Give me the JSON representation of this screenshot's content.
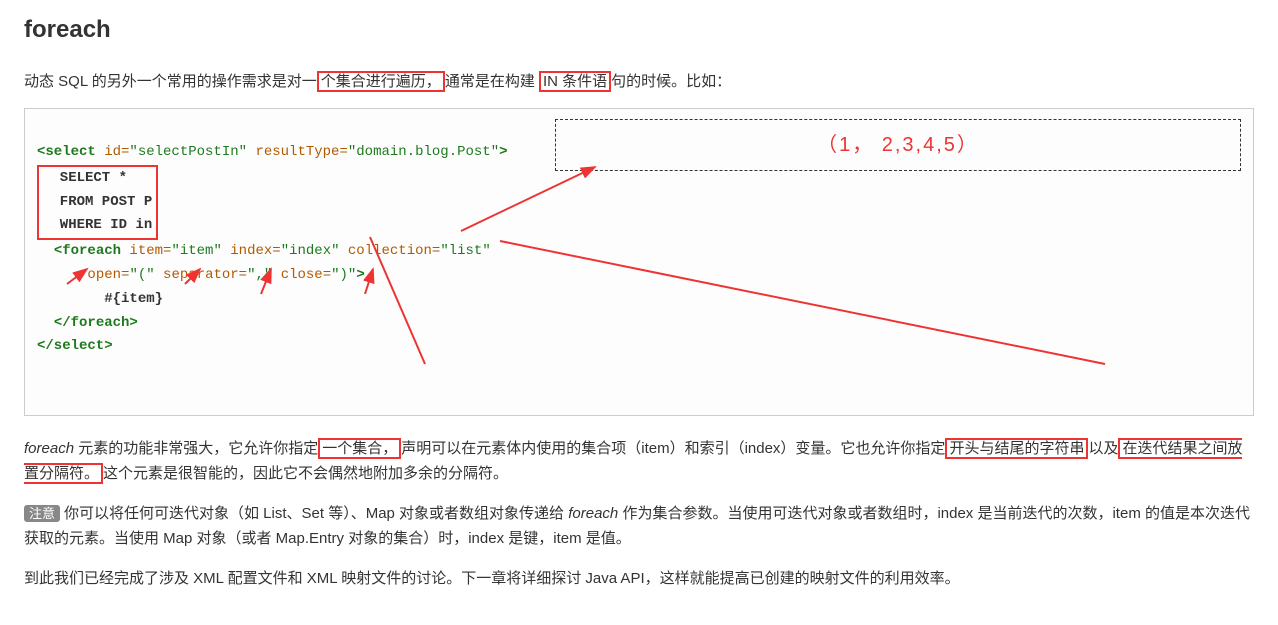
{
  "heading": "foreach",
  "intro": {
    "p1a": "动态 SQL 的另外一个常用的操作需求是对一",
    "hl1": "个集合进行遍历，",
    "p1b": "通常是在构建 ",
    "hl2": "IN 条件语",
    "p1c": "句的时候。比如："
  },
  "code": {
    "l1_open": "<select",
    "l1_id_attr": " id=",
    "l1_id_val": "\"selectPostIn\"",
    "l1_rt_attr": " resultType=",
    "l1_rt_val": "\"domain.blog.Post\"",
    "l1_close": ">",
    "l2": "  SELECT *",
    "l3": "  FROM POST P",
    "l4": "  WHERE ID in",
    "l5_indent": "  ",
    "l5_open": "<foreach",
    "l5_item_a": " item=",
    "l5_item_v": "\"item\"",
    "l5_idx_a": " index=",
    "l5_idx_v": "\"index\"",
    "l5_col_a": " collection=",
    "l5_col_v": "\"list\"",
    "l6_indent": "      ",
    "l6_open_a": "open=",
    "l6_open_v": "\"(\"",
    "l6_sep_a": " separator=",
    "l6_sep_v": "\",\"",
    "l6_close_a": " close=",
    "l6_close_v": "\")\"",
    "l6_gt": ">",
    "l7": "        #{item}",
    "l8_indent": "  ",
    "l8": "</foreach>",
    "l9": "</select>"
  },
  "dashbox_text": "（1， 2,3,4,5）",
  "para2": {
    "a": "foreach",
    "b": " 元素的功能非常强大，它允许你指定",
    "hl1": "一个集合，",
    "c": "声明可以在元素体内使用的集合项（item）和索引（index）变量。它也允许你指定",
    "hl2": "开头与结尾的字符串",
    "d": "以及",
    "hl3": "在迭代结果之间放置分隔符。",
    "e": "这个元素是很智能的，因此它不会偶然地附加多余的分隔符。"
  },
  "para3": {
    "tag": "注意",
    "a": "你可以将任何可迭代对象（如 List、Set 等）、Map 对象或者数组对象传递给 ",
    "b": "foreach",
    "c": " 作为集合参数。当使用可迭代对象或者数组时，index 是当前迭代的次数，item 的值是本次迭代获取的元素。当使用 Map 对象（或者 Map.Entry 对象的集合）时，index 是键，item 是值。"
  },
  "para4": "到此我们已经完成了涉及 XML 配置文件和 XML 映射文件的讨论。下一章将详细探讨 Java API，这样就能提高已创建的映射文件的利用效率。"
}
